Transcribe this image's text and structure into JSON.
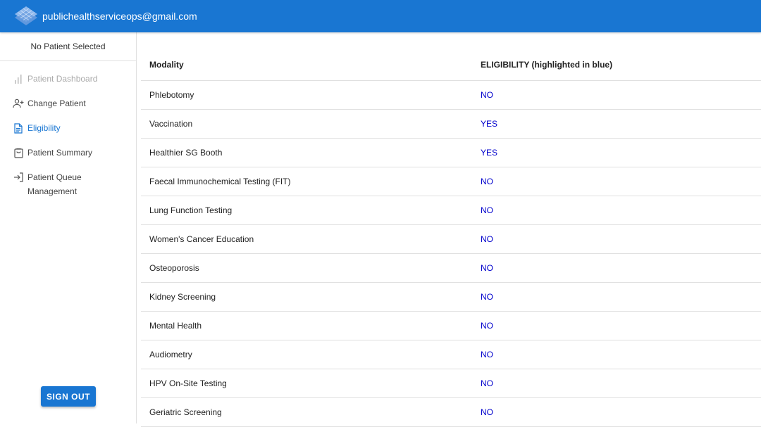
{
  "header": {
    "account_email": "publichealthserviceops@gmail.com"
  },
  "colors": {
    "brand": "#1976d2",
    "eligibility_value": "#0000cc"
  },
  "sidebar": {
    "patient_status": "No Patient Selected",
    "items": [
      {
        "label": "Patient Dashboard",
        "icon": "bar-chart-icon",
        "state": "disabled"
      },
      {
        "label": "Change Patient",
        "icon": "person-add-icon",
        "state": "normal"
      },
      {
        "label": "Eligibility",
        "icon": "document-icon",
        "state": "active"
      },
      {
        "label": "Patient Summary",
        "icon": "clipboard-icon",
        "state": "normal"
      },
      {
        "label": "Patient Queue Management",
        "icon": "login-arrow-icon",
        "state": "normal"
      }
    ],
    "sign_out_label": "SIGN OUT"
  },
  "table": {
    "headers": [
      "Modality",
      "ELIGIBILITY (highlighted in blue)"
    ],
    "rows": [
      {
        "modality": "Phlebotomy",
        "eligibility": "NO"
      },
      {
        "modality": "Vaccination",
        "eligibility": "YES"
      },
      {
        "modality": "Healthier SG Booth",
        "eligibility": "YES"
      },
      {
        "modality": "Faecal Immunochemical Testing (FIT)",
        "eligibility": "NO"
      },
      {
        "modality": "Lung Function Testing",
        "eligibility": "NO"
      },
      {
        "modality": "Women's Cancer Education",
        "eligibility": "NO"
      },
      {
        "modality": "Osteoporosis",
        "eligibility": "NO"
      },
      {
        "modality": "Kidney Screening",
        "eligibility": "NO"
      },
      {
        "modality": "Mental Health",
        "eligibility": "NO"
      },
      {
        "modality": "Audiometry",
        "eligibility": "NO"
      },
      {
        "modality": "HPV On-Site Testing",
        "eligibility": "NO"
      },
      {
        "modality": "Geriatric Screening",
        "eligibility": "NO"
      }
    ]
  }
}
